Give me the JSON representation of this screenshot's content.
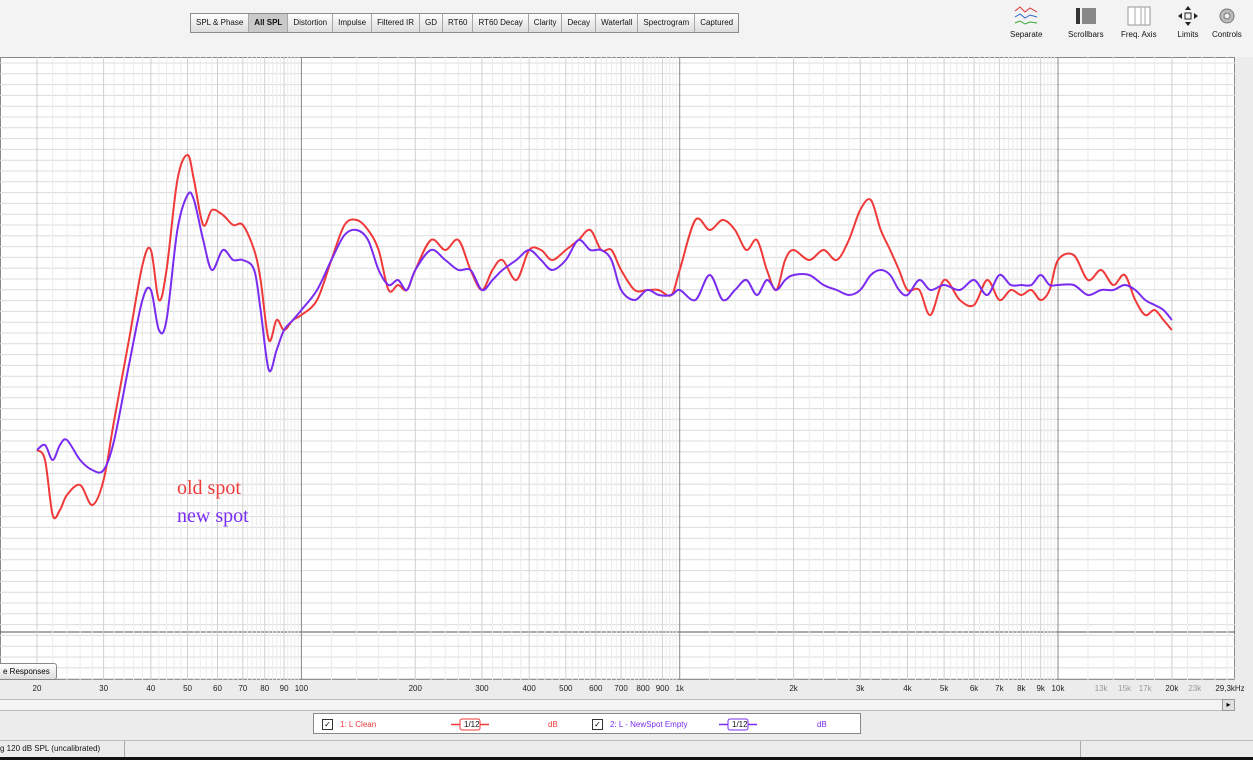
{
  "tabs": [
    "SPL & Phase",
    "All SPL",
    "Distortion",
    "Impulse",
    "Filtered IR",
    "GD",
    "RT60",
    "RT60 Decay",
    "Clarity",
    "Decay",
    "Waterfall",
    "Spectrogram",
    "Captured"
  ],
  "active_tab": "All SPL",
  "tools": {
    "separate": "Separate",
    "scrollbars": "Scrollbars",
    "freq_axis": "Freq. Axis",
    "limits": "Limits",
    "controls": "Controls"
  },
  "responses_button": "e Responses",
  "annotations": {
    "old": "old spot",
    "new": "new spot"
  },
  "x_ticks": [
    {
      "label": "20",
      "f": 20
    },
    {
      "label": "30",
      "f": 30
    },
    {
      "label": "40",
      "f": 40
    },
    {
      "label": "50",
      "f": 50
    },
    {
      "label": "60",
      "f": 60
    },
    {
      "label": "70",
      "f": 70
    },
    {
      "label": "80",
      "f": 80
    },
    {
      "label": "90",
      "f": 90
    },
    {
      "label": "100",
      "f": 100
    },
    {
      "label": "200",
      "f": 200
    },
    {
      "label": "300",
      "f": 300
    },
    {
      "label": "400",
      "f": 400
    },
    {
      "label": "500",
      "f": 500
    },
    {
      "label": "600",
      "f": 600
    },
    {
      "label": "700",
      "f": 700
    },
    {
      "label": "800",
      "f": 800
    },
    {
      "label": "900",
      "f": 900
    },
    {
      "label": "1k",
      "f": 1000
    },
    {
      "label": "2k",
      "f": 2000
    },
    {
      "label": "3k",
      "f": 3000
    },
    {
      "label": "4k",
      "f": 4000
    },
    {
      "label": "5k",
      "f": 5000
    },
    {
      "label": "6k",
      "f": 6000
    },
    {
      "label": "7k",
      "f": 7000
    },
    {
      "label": "8k",
      "f": 8000
    },
    {
      "label": "9k",
      "f": 9000
    },
    {
      "label": "10k",
      "f": 10000
    },
    {
      "label": "13k",
      "f": 13000,
      "gray": true
    },
    {
      "label": "15k",
      "f": 15000,
      "gray": true
    },
    {
      "label": "17k",
      "f": 17000,
      "gray": true
    },
    {
      "label": "20k",
      "f": 20000
    },
    {
      "label": "23k",
      "f": 23000,
      "gray": true
    },
    {
      "label": "29,3kHz",
      "f": 29300
    }
  ],
  "legend": {
    "m1_label": "1: L Clean",
    "m1_smoothing": "1/12",
    "m1_unit": "dB",
    "m2_label": "2: L - NewSpot Empty",
    "m2_smoothing": "1/12",
    "m2_unit": "dB"
  },
  "status": "g 120 dB SPL (uncalibrated)",
  "colors": {
    "old": "#f03a3a",
    "new": "#7a2cf0"
  },
  "chart_data": {
    "type": "line",
    "xscale": "log",
    "xlim": [
      14,
      30000
    ],
    "xlabel": "Hz",
    "series": [
      {
        "name": "1: L Clean",
        "color": "#f03a3a",
        "points": [
          [
            20,
            -2
          ],
          [
            21,
            -4
          ],
          [
            22,
            -15
          ],
          [
            23,
            -14
          ],
          [
            24,
            -11
          ],
          [
            26,
            -9
          ],
          [
            28,
            -13
          ],
          [
            30,
            -8
          ],
          [
            32,
            4
          ],
          [
            35,
            20
          ],
          [
            38,
            35
          ],
          [
            40,
            38
          ],
          [
            42,
            28
          ],
          [
            44,
            34
          ],
          [
            47,
            52
          ],
          [
            50,
            57
          ],
          [
            52,
            52
          ],
          [
            55,
            43
          ],
          [
            58,
            46
          ],
          [
            62,
            45
          ],
          [
            66,
            43
          ],
          [
            70,
            43
          ],
          [
            75,
            38
          ],
          [
            78,
            32
          ],
          [
            82,
            20
          ],
          [
            86,
            24
          ],
          [
            90,
            22
          ],
          [
            95,
            24
          ],
          [
            100,
            25
          ],
          [
            110,
            28
          ],
          [
            120,
            36
          ],
          [
            130,
            43
          ],
          [
            140,
            44
          ],
          [
            150,
            42
          ],
          [
            160,
            38
          ],
          [
            170,
            30
          ],
          [
            180,
            31
          ],
          [
            190,
            30
          ],
          [
            200,
            34
          ],
          [
            220,
            40
          ],
          [
            240,
            38
          ],
          [
            260,
            40
          ],
          [
            280,
            34
          ],
          [
            300,
            30
          ],
          [
            320,
            34
          ],
          [
            340,
            36
          ],
          [
            370,
            32
          ],
          [
            400,
            38
          ],
          [
            430,
            38
          ],
          [
            460,
            36
          ],
          [
            500,
            38
          ],
          [
            540,
            40
          ],
          [
            580,
            42
          ],
          [
            620,
            38
          ],
          [
            660,
            38
          ],
          [
            700,
            34
          ],
          [
            760,
            30
          ],
          [
            820,
            30
          ],
          [
            880,
            30
          ],
          [
            950,
            29
          ],
          [
            1000,
            34
          ],
          [
            1100,
            44
          ],
          [
            1200,
            42
          ],
          [
            1300,
            44
          ],
          [
            1400,
            42
          ],
          [
            1500,
            38
          ],
          [
            1600,
            40
          ],
          [
            1700,
            34
          ],
          [
            1800,
            30
          ],
          [
            1900,
            36
          ],
          [
            2000,
            38
          ],
          [
            2200,
            36
          ],
          [
            2400,
            38
          ],
          [
            2600,
            36
          ],
          [
            2800,
            40
          ],
          [
            3000,
            46
          ],
          [
            3200,
            48
          ],
          [
            3400,
            42
          ],
          [
            3600,
            38
          ],
          [
            3800,
            34
          ],
          [
            4000,
            30
          ],
          [
            4300,
            30
          ],
          [
            4600,
            25
          ],
          [
            5000,
            32
          ],
          [
            5500,
            28
          ],
          [
            6000,
            27
          ],
          [
            6500,
            32
          ],
          [
            7000,
            28
          ],
          [
            7500,
            30
          ],
          [
            8000,
            29
          ],
          [
            8500,
            30
          ],
          [
            9000,
            28
          ],
          [
            9500,
            30
          ],
          [
            10000,
            36
          ],
          [
            11000,
            37
          ],
          [
            12000,
            32
          ],
          [
            13000,
            34
          ],
          [
            14000,
            31
          ],
          [
            15000,
            33
          ],
          [
            16000,
            28
          ],
          [
            17000,
            25
          ],
          [
            18000,
            26
          ],
          [
            19000,
            24
          ],
          [
            20000,
            22
          ]
        ]
      },
      {
        "name": "2: L - NewSpot Empty",
        "color": "#7a2cf0",
        "points": [
          [
            20,
            -2
          ],
          [
            21,
            -1
          ],
          [
            22,
            -4
          ],
          [
            23,
            -1
          ],
          [
            24,
            0
          ],
          [
            26,
            -4
          ],
          [
            28,
            -6
          ],
          [
            30,
            -6
          ],
          [
            32,
            0
          ],
          [
            35,
            15
          ],
          [
            38,
            28
          ],
          [
            40,
            30
          ],
          [
            42,
            22
          ],
          [
            44,
            24
          ],
          [
            47,
            42
          ],
          [
            50,
            49
          ],
          [
            52,
            48
          ],
          [
            55,
            40
          ],
          [
            58,
            34
          ],
          [
            62,
            38
          ],
          [
            66,
            36
          ],
          [
            70,
            36
          ],
          [
            75,
            34
          ],
          [
            78,
            26
          ],
          [
            82,
            14
          ],
          [
            86,
            18
          ],
          [
            90,
            22
          ],
          [
            95,
            24
          ],
          [
            100,
            26
          ],
          [
            110,
            30
          ],
          [
            120,
            36
          ],
          [
            130,
            41
          ],
          [
            140,
            42
          ],
          [
            150,
            40
          ],
          [
            160,
            34
          ],
          [
            170,
            31
          ],
          [
            180,
            32
          ],
          [
            190,
            30
          ],
          [
            200,
            34
          ],
          [
            220,
            38
          ],
          [
            240,
            36
          ],
          [
            260,
            34
          ],
          [
            280,
            34
          ],
          [
            300,
            30
          ],
          [
            320,
            32
          ],
          [
            340,
            34
          ],
          [
            370,
            36
          ],
          [
            400,
            38
          ],
          [
            430,
            36
          ],
          [
            460,
            34
          ],
          [
            500,
            36
          ],
          [
            540,
            40
          ],
          [
            580,
            38
          ],
          [
            620,
            38
          ],
          [
            660,
            36
          ],
          [
            700,
            30
          ],
          [
            760,
            28
          ],
          [
            820,
            30
          ],
          [
            880,
            29
          ],
          [
            950,
            29
          ],
          [
            1000,
            30
          ],
          [
            1100,
            28
          ],
          [
            1200,
            33
          ],
          [
            1300,
            28
          ],
          [
            1400,
            30
          ],
          [
            1500,
            32
          ],
          [
            1600,
            29
          ],
          [
            1700,
            32
          ],
          [
            1800,
            30
          ],
          [
            1900,
            32
          ],
          [
            2000,
            33
          ],
          [
            2200,
            33
          ],
          [
            2400,
            31
          ],
          [
            2600,
            30
          ],
          [
            2800,
            29
          ],
          [
            3000,
            30
          ],
          [
            3200,
            33
          ],
          [
            3400,
            34
          ],
          [
            3600,
            33
          ],
          [
            3800,
            30
          ],
          [
            4000,
            29
          ],
          [
            4300,
            32
          ],
          [
            4600,
            30
          ],
          [
            5000,
            31
          ],
          [
            5500,
            30
          ],
          [
            6000,
            32
          ],
          [
            6500,
            29
          ],
          [
            7000,
            33
          ],
          [
            7500,
            31
          ],
          [
            8000,
            31
          ],
          [
            8500,
            31
          ],
          [
            9000,
            33
          ],
          [
            9500,
            31
          ],
          [
            10000,
            31
          ],
          [
            11000,
            31
          ],
          [
            12000,
            29
          ],
          [
            13000,
            30
          ],
          [
            14000,
            30
          ],
          [
            15000,
            31
          ],
          [
            16000,
            30
          ],
          [
            17000,
            28
          ],
          [
            18000,
            27
          ],
          [
            19000,
            26
          ],
          [
            20000,
            24
          ]
        ]
      }
    ]
  }
}
